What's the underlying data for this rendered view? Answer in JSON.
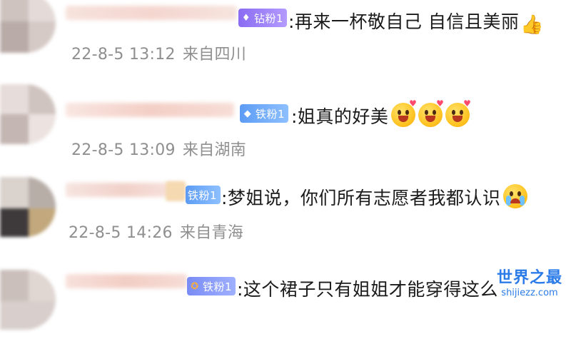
{
  "comments": [
    {
      "badge": "钻粉1",
      "badge_type": "diamond",
      "badge_icon": "diamond-icon",
      "text": ":再来一杯敬自己  自信且美丽",
      "emojis": [
        "thumbs-up-icon"
      ],
      "time": "22-8-5 13:12",
      "location": "来自四川"
    },
    {
      "badge": "铁粉1",
      "badge_type": "iron",
      "badge_icon": "gem-icon",
      "text": ":姐真的好美",
      "emojis": [
        "love-face-icon",
        "love-face-icon",
        "love-face-icon"
      ],
      "time": "22-8-5 13:09",
      "location": "来自湖南"
    },
    {
      "badge": "铁粉1",
      "badge_type": "iron",
      "badge_icon": "gem-icon",
      "text": ":梦姐说，你们所有志愿者我都认识",
      "emojis": [
        "crying-face-icon"
      ],
      "time": "22-8-5 14:26",
      "location": "来自青海"
    },
    {
      "badge": "铁粉1",
      "badge_type": "iron",
      "badge_icon": "medal-icon",
      "text": ":这个裙子只有姐姐才能穿得这么"
    }
  ],
  "watermark": {
    "title": "世界之最",
    "url": "shijiezz.com"
  },
  "colors": {
    "diamond_badge": "#8a6cf2",
    "iron_badge": "#5d9cf4",
    "meta_text": "#8f8f8f",
    "watermark": "#2b7be8"
  }
}
